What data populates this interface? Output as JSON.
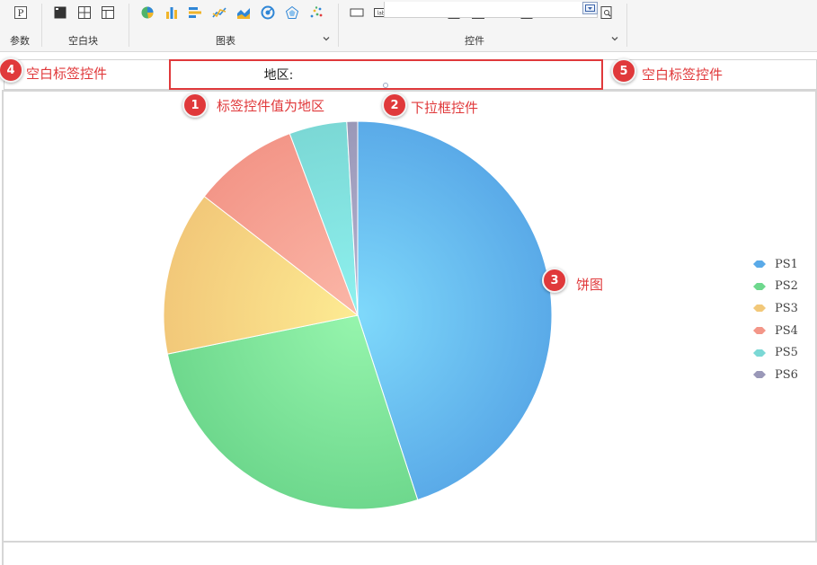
{
  "toolbar": {
    "groups": [
      {
        "label": "参数"
      },
      {
        "label": "空白块"
      },
      {
        "label": "图表"
      },
      {
        "label": "控件"
      }
    ]
  },
  "param_row": {
    "label_value": "地区:",
    "combo_value": ""
  },
  "annotations": [
    {
      "num": "1",
      "text": "标签控件值为地区"
    },
    {
      "num": "2",
      "text": "下拉框控件"
    },
    {
      "num": "3",
      "text": "饼图"
    },
    {
      "num": "4",
      "text": "空白标签控件"
    },
    {
      "num": "5",
      "text": "空白标签控件"
    }
  ],
  "colors": {
    "annotation_red": "#e0393b",
    "PS1": "#5aaae8",
    "PS2": "#6ed88d",
    "PS3": "#f2c879",
    "PS4": "#f39688",
    "PS5": "#7bd8d5",
    "PS6": "#9a98b8"
  },
  "chart_data": {
    "type": "pie",
    "categories": [
      "PS1",
      "PS2",
      "PS3",
      "PS4",
      "PS5",
      "PS6"
    ],
    "values": [
      45.0,
      26.8,
      13.7,
      8.8,
      4.8,
      0.9
    ],
    "legend": {
      "position": "right",
      "entries": [
        "PS1",
        "PS2",
        "PS3",
        "PS4",
        "PS5",
        "PS6"
      ]
    }
  }
}
